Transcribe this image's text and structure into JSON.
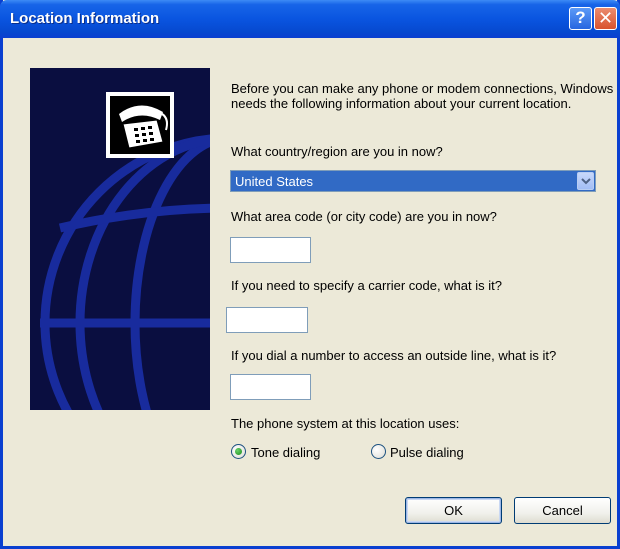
{
  "window": {
    "title": "Location Information",
    "help_glyph": "?",
    "close_glyph": "✕"
  },
  "colors": {
    "title_bar": "#0a55e0",
    "dialog_background": "#ece9d8",
    "selection": "#316ac5",
    "side_panel": "#0a0e40"
  },
  "icons": {
    "side_image": "telephone-globe-icon",
    "dropdown": "chevron-down-icon"
  },
  "form": {
    "intro": "Before you can make any phone or modem connections, Windows needs the following information about your current location.",
    "country_label": "What country/region are you in now?",
    "country_value": "United States",
    "area_code_label": "What area code (or city code) are you in now?",
    "area_code_value": "",
    "carrier_code_label": "If you need to specify a carrier code, what is it?",
    "carrier_code_value": "",
    "outside_line_label": "If you dial a number to access an outside line, what is it?",
    "outside_line_value": "",
    "phone_system_label": "The phone system at this location uses:",
    "tone_label": "Tone dialing",
    "pulse_label": "Pulse dialing",
    "selected_dialing": "tone"
  },
  "buttons": {
    "ok": "OK",
    "cancel": "Cancel"
  }
}
